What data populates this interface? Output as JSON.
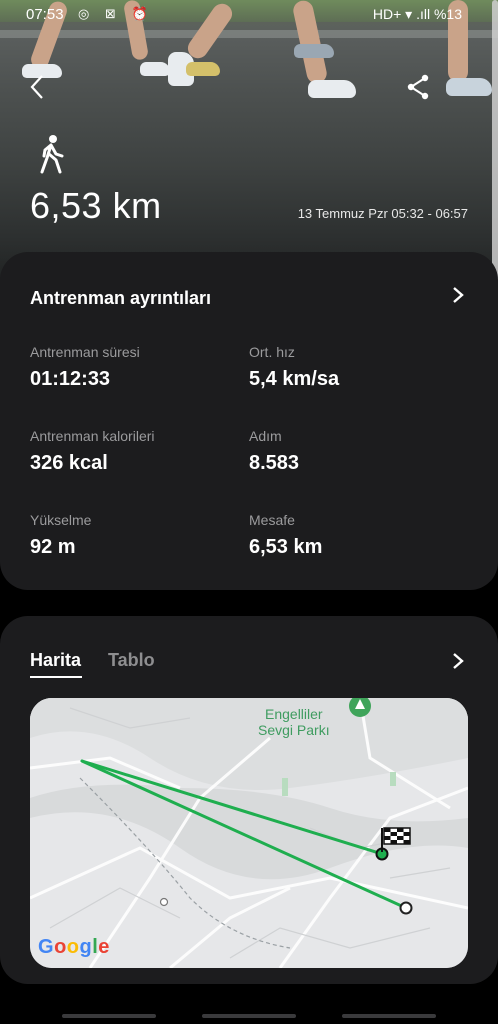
{
  "status_bar": {
    "time": "07:53",
    "left_icons": "◎ ⊠ ⏰",
    "right": "HD+ ▾ .ıll %13"
  },
  "hero": {
    "activity_icon": "walking-person-icon",
    "distance": "6,53 km",
    "date_range": "13 Temmuz Pzr 05:32 - 06:57"
  },
  "details": {
    "title": "Antrenman ayrıntıları",
    "stats": [
      {
        "label": "Antrenman süresi",
        "value": "01:12:33"
      },
      {
        "label": "Ort. hız",
        "value": "5,4 km/sa"
      },
      {
        "label": "Antrenman kalorileri",
        "value": "326 kcal"
      },
      {
        "label": "Adım",
        "value": "8.583"
      },
      {
        "label": "Yükselme",
        "value": "92 m"
      },
      {
        "label": "Mesafe",
        "value": "6,53 km"
      }
    ]
  },
  "map_section": {
    "tabs": [
      "Harita",
      "Tablo"
    ],
    "active_tab": "Harita",
    "park_label_line1": "Engelliler",
    "park_label_line2": "Sevgi Parkı",
    "google_logo": "Google"
  },
  "colors": {
    "route": "#1fae4f",
    "card_bg": "#1c1c1e",
    "label_gray": "#9b9b9d"
  }
}
